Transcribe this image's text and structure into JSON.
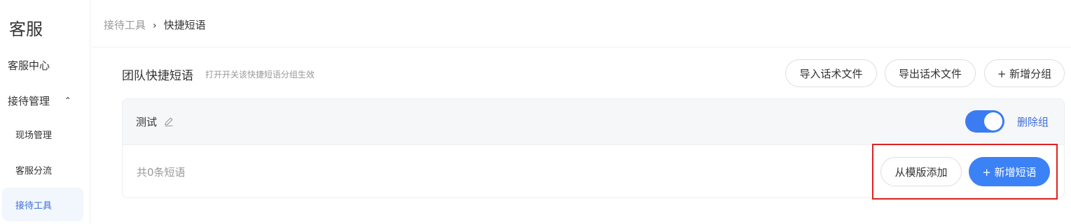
{
  "sidebar": {
    "title": "客服",
    "items": [
      {
        "label": "客服中心"
      },
      {
        "label": "接待管理",
        "caret": "⌃"
      },
      {
        "label": "现场管理"
      },
      {
        "label": "客服分流"
      },
      {
        "label": "接待工具"
      }
    ]
  },
  "breadcrumb": {
    "parent": "接待工具",
    "separator": "›",
    "current": "快捷短语"
  },
  "section": {
    "title": "团队快捷短语",
    "subtitle": "打开开关该快捷短语分组生效",
    "buttons": {
      "import": "导入话术文件",
      "export": "导出话术文件",
      "add_group": "+ 新增分组"
    }
  },
  "group": {
    "name": "测试",
    "enabled": true,
    "delete_label": "删除组",
    "count_text": "共0条短语",
    "from_template_label": "从模版添加",
    "add_phrase_label": "+ 新增短语"
  },
  "colors": {
    "accent": "#3b82f6",
    "link": "#3b6fd9",
    "highlight": "#e02020"
  }
}
